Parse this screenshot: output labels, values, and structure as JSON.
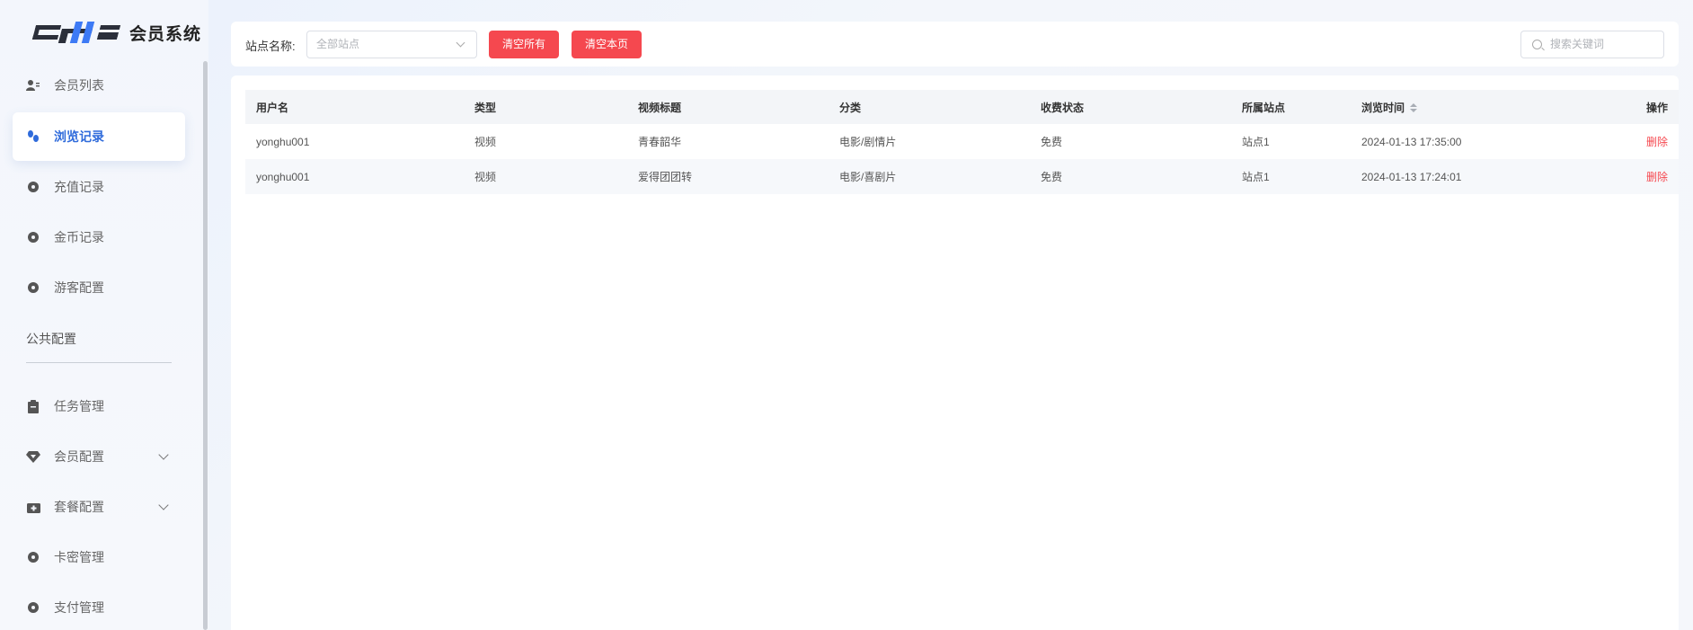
{
  "app": {
    "title": "会员系统"
  },
  "sidebar": {
    "items": [
      {
        "label": "会员列表",
        "icon": "member-list-icon"
      },
      {
        "label": "浏览记录",
        "icon": "footprint-icon",
        "active": true
      },
      {
        "label": "充值记录",
        "icon": "dot-icon"
      },
      {
        "label": "金币记录",
        "icon": "dot-icon"
      },
      {
        "label": "游客配置",
        "icon": "dot-icon"
      }
    ],
    "section_label": "公共配置",
    "items2": [
      {
        "label": "任务管理",
        "icon": "clipboard-icon"
      },
      {
        "label": "会员配置",
        "icon": "diamond-icon",
        "expandable": true
      },
      {
        "label": "套餐配置",
        "icon": "package-icon",
        "expandable": true
      },
      {
        "label": "卡密管理",
        "icon": "dot-icon"
      },
      {
        "label": "支付管理",
        "icon": "dot-icon"
      }
    ]
  },
  "toolbar": {
    "filter_label": "站点名称:",
    "site_select_value": "全部站点",
    "clear_all_label": "清空所有",
    "clear_page_label": "清空本页",
    "search_placeholder": "搜索关键词"
  },
  "table": {
    "columns": [
      "用户名",
      "类型",
      "视频标题",
      "分类",
      "收费状态",
      "所属站点",
      "浏览时间",
      "操作"
    ],
    "rows": [
      {
        "username": "yonghu001",
        "type": "视频",
        "title": "青春韶华",
        "category": "电影/剧情片",
        "fee": "免费",
        "site": "站点1",
        "time": "2024-01-13 17:35:00",
        "action": "删除"
      },
      {
        "username": "yonghu001",
        "type": "视频",
        "title": "爱得团团转",
        "category": "电影/喜剧片",
        "fee": "免费",
        "site": "站点1",
        "time": "2024-01-13 17:24:01",
        "action": "删除"
      }
    ]
  },
  "colors": {
    "accent": "#2f6bdb",
    "danger": "#f5484f"
  }
}
